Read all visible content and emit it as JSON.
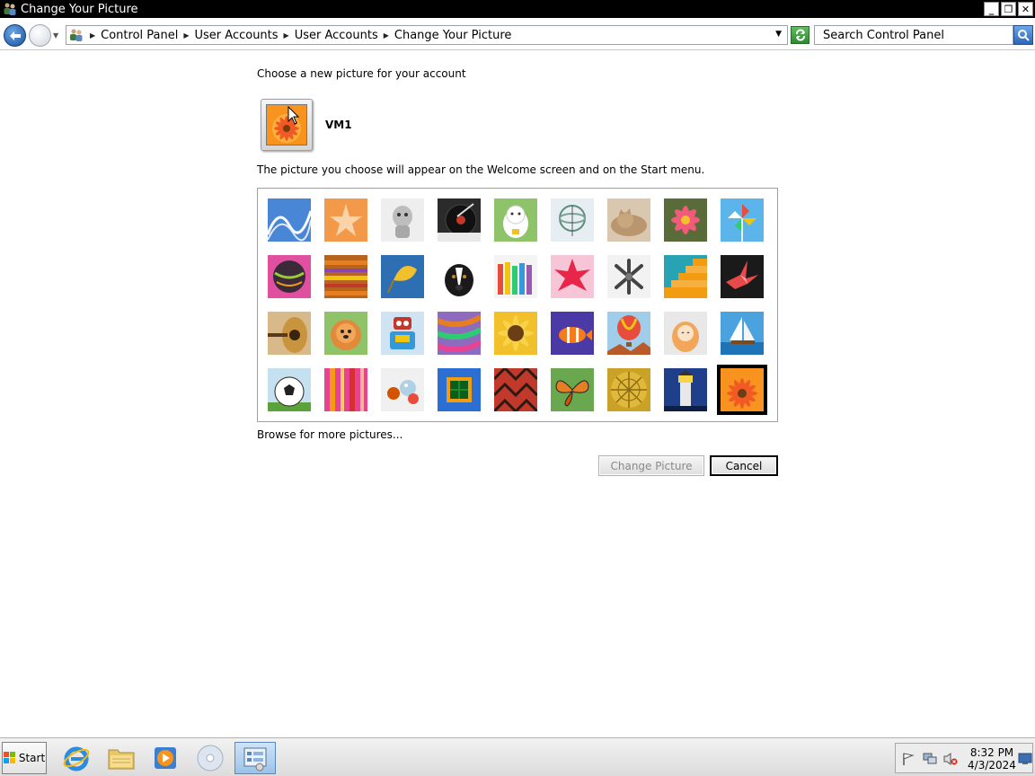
{
  "window": {
    "title": "Change Your Picture",
    "controls": {
      "minimize": "_",
      "restore": "❐",
      "close": "✕"
    }
  },
  "address_bar": {
    "breadcrumbs": [
      "Control Panel",
      "User Accounts",
      "User Accounts",
      "Change Your Picture"
    ],
    "search_placeholder": "Search Control Panel"
  },
  "main": {
    "heading": "Choose a new picture for your account",
    "username": "VM1",
    "info_text": "The picture you choose will appear on the Welcome screen and on the Start menu.",
    "pictures": [
      {
        "name": "roller-coaster",
        "selected": false
      },
      {
        "name": "starfish",
        "selected": false
      },
      {
        "name": "robot-toy",
        "selected": false
      },
      {
        "name": "record-player",
        "selected": false
      },
      {
        "name": "lucky-cat",
        "selected": false
      },
      {
        "name": "gyroscope",
        "selected": false
      },
      {
        "name": "kitten",
        "selected": false
      },
      {
        "name": "pink-flower",
        "selected": false
      },
      {
        "name": "pinwheel",
        "selected": false
      },
      {
        "name": "ball",
        "selected": false
      },
      {
        "name": "fabric",
        "selected": false
      },
      {
        "name": "leaf",
        "selected": false
      },
      {
        "name": "dog",
        "selected": false
      },
      {
        "name": "crayons",
        "selected": false
      },
      {
        "name": "paper-star",
        "selected": false
      },
      {
        "name": "jacks",
        "selected": false
      },
      {
        "name": "stairs",
        "selected": false
      },
      {
        "name": "paper-crane",
        "selected": false
      },
      {
        "name": "guitar",
        "selected": false
      },
      {
        "name": "pomeranian",
        "selected": false
      },
      {
        "name": "tin-robot",
        "selected": false
      },
      {
        "name": "scarves",
        "selected": false
      },
      {
        "name": "sunflower",
        "selected": false
      },
      {
        "name": "clownfish",
        "selected": false
      },
      {
        "name": "hot-air-balloon",
        "selected": false
      },
      {
        "name": "doll",
        "selected": false
      },
      {
        "name": "sailboat",
        "selected": false
      },
      {
        "name": "soccer-ball",
        "selected": false
      },
      {
        "name": "striped-fabric",
        "selected": false
      },
      {
        "name": "marbles",
        "selected": false
      },
      {
        "name": "window-frame",
        "selected": false
      },
      {
        "name": "patterned-cloth",
        "selected": false
      },
      {
        "name": "butterfly",
        "selected": false
      },
      {
        "name": "woven-basket",
        "selected": false
      },
      {
        "name": "lighthouse",
        "selected": false
      },
      {
        "name": "orange-flower",
        "selected": true
      }
    ],
    "browse_link": "Browse for more pictures...",
    "change_button": "Change Picture",
    "cancel_button": "Cancel"
  },
  "taskbar": {
    "start_label": "Start",
    "apps": [
      "internet-explorer",
      "file-explorer",
      "media-player",
      "disc",
      "control-panel"
    ],
    "time": "8:32 PM",
    "date": "4/3/2024"
  },
  "colors": {
    "titlebar": "#000000",
    "selection_outline": "#000000",
    "background": "#ffffff"
  }
}
